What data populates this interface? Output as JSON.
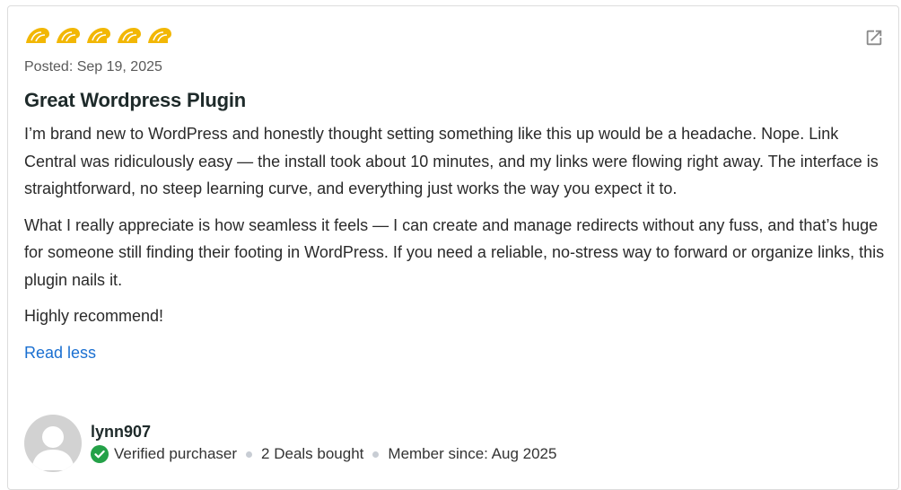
{
  "review": {
    "rating": 5,
    "posted": "Posted: Sep 19, 2025",
    "title": "Great Wordpress Plugin",
    "paragraphs": [
      "I’m brand new to WordPress and honestly thought setting something like this up would be a headache. Nope. Link Central was ridiculously easy — the install took about 10 minutes, and my links were flowing right away. The interface is straightforward, no steep learning curve, and everything just works the way you expect it to.",
      "What I really appreciate is how seamless it feels — I can create and manage redirects without any fuss, and that’s huge for someone still finding their footing in WordPress. If you need a reliable, no-stress way to forward or organize links, this plugin nails it.",
      "Highly recommend!"
    ],
    "read_less": "Read less"
  },
  "reviewer": {
    "username": "lynn907",
    "verified": "Verified purchaser",
    "deals": "2 Deals bought",
    "member_since": "Member since: Aug 2025"
  },
  "icons": {
    "star": "taco-star-icon",
    "external": "external-link-icon",
    "verified": "check-circle-icon",
    "avatar": "user-avatar-icon"
  },
  "colors": {
    "star": "#f2b705",
    "link": "#1a6fd1",
    "verified": "#24a148"
  }
}
